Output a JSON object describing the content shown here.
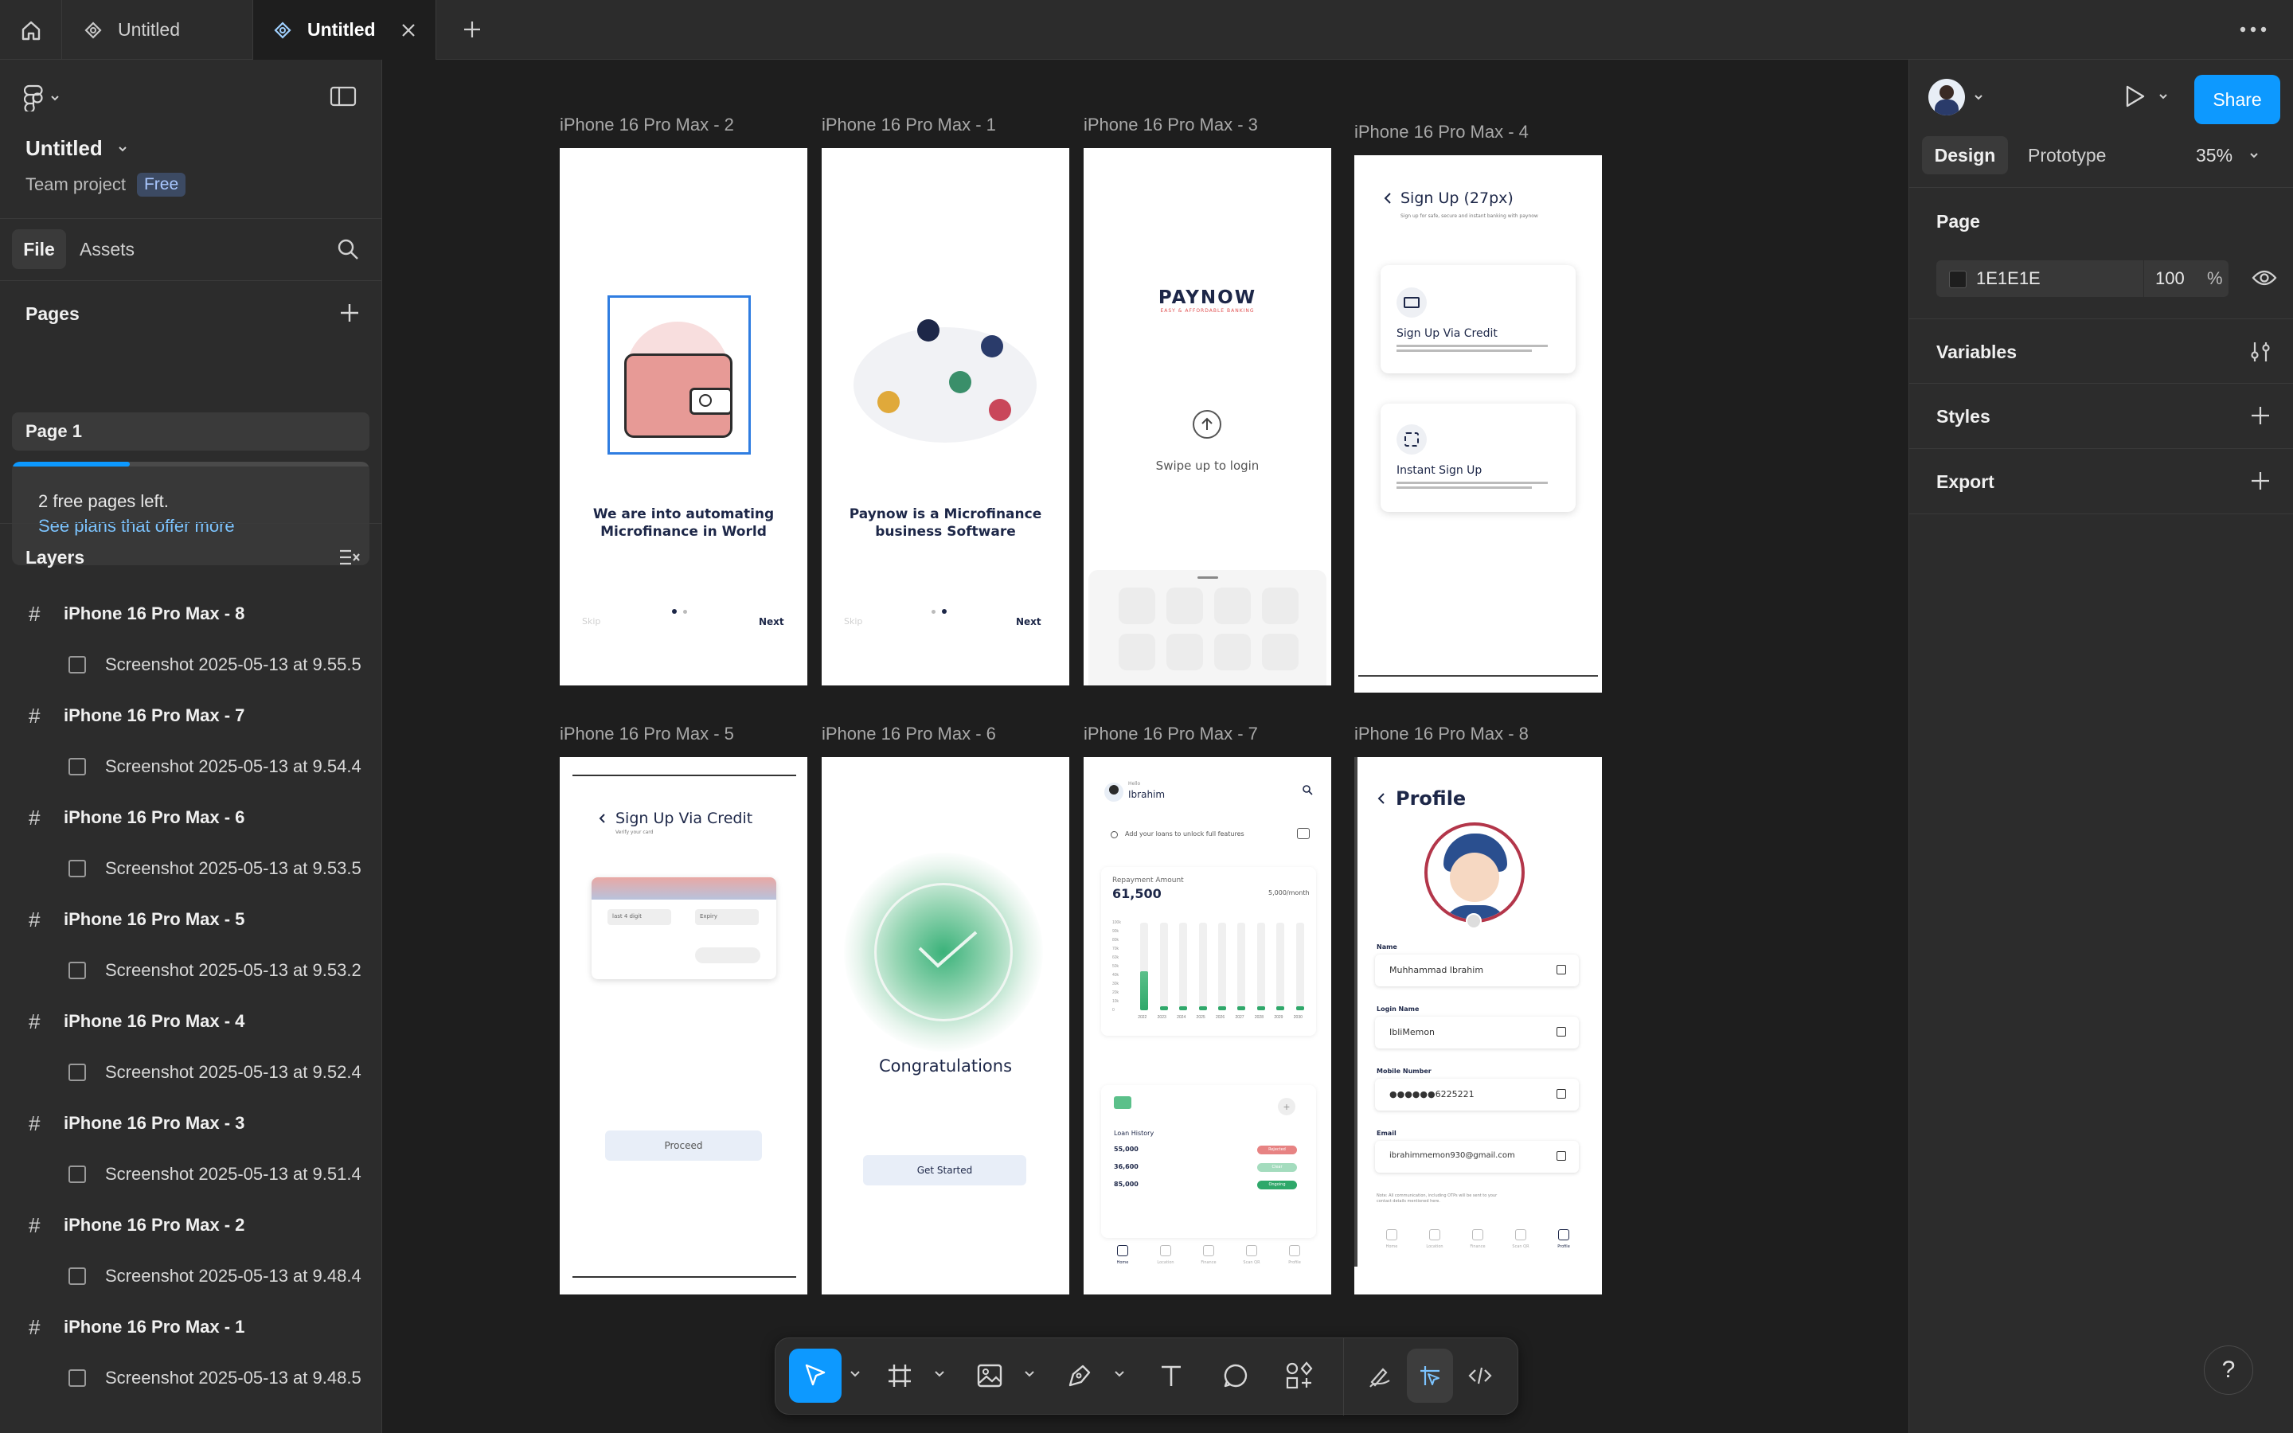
{
  "tabs": {
    "home_icon": "home-icon",
    "items": [
      {
        "label": "Untitled",
        "active": false
      },
      {
        "label": "Untitled",
        "active": true
      }
    ],
    "new_tab_icon": "plus-icon",
    "more_icon": "more-horizontal-icon"
  },
  "file": {
    "name": "Untitled",
    "team": "Team project",
    "plan_badge": "Free"
  },
  "left_tabs": {
    "file": "File",
    "assets": "Assets"
  },
  "pages": {
    "heading": "Pages",
    "items": [
      "Page 1"
    ],
    "limit_text": "2 free pages left.",
    "plans_link": "See plans that offer more",
    "usage_fraction": 0.33
  },
  "layers": {
    "heading": "Layers",
    "items": [
      {
        "frame": "iPhone 16 Pro Max - 8",
        "child": "Screenshot 2025-05-13 at 9.55.5"
      },
      {
        "frame": "iPhone 16 Pro Max - 7",
        "child": "Screenshot 2025-05-13 at 9.54.4"
      },
      {
        "frame": "iPhone 16 Pro Max - 6",
        "child": "Screenshot 2025-05-13 at 9.53.5"
      },
      {
        "frame": "iPhone 16 Pro Max - 5",
        "child": "Screenshot 2025-05-13 at 9.53.2"
      },
      {
        "frame": "iPhone 16 Pro Max - 4",
        "child": "Screenshot 2025-05-13 at 9.52.4"
      },
      {
        "frame": "iPhone 16 Pro Max - 3",
        "child": "Screenshot 2025-05-13 at 9.51.4"
      },
      {
        "frame": "iPhone 16 Pro Max - 2",
        "child": "Screenshot 2025-05-13 at 9.48.4"
      },
      {
        "frame": "iPhone 16 Pro Max - 1",
        "child": "Screenshot 2025-05-13 at 9.48.5"
      }
    ]
  },
  "right": {
    "share": "Share",
    "tab_design": "Design",
    "tab_prototype": "Prototype",
    "zoom": "35%",
    "page_heading": "Page",
    "page_color": "1E1E1E",
    "page_opacity": "100",
    "percent": "%",
    "variables": "Variables",
    "styles": "Styles",
    "export": "Export"
  },
  "frames": {
    "f2": {
      "label": "iPhone 16 Pro Max - 2",
      "headline1": "We are into automating",
      "headline2": "Microfinance in World",
      "skip": "Skip",
      "next": "Next"
    },
    "f1": {
      "label": "iPhone 16 Pro Max - 1",
      "headline1": "Paynow is a Microfinance",
      "headline2": "business  Software",
      "skip": "Skip",
      "next": "Next"
    },
    "f3": {
      "label": "iPhone 16 Pro Max - 3",
      "brand": "PAYNOW",
      "tagline": "EASY & AFFORDABLE BANKING",
      "swipe": "Swipe up to login"
    },
    "f4": {
      "label": "iPhone 16 Pro Max - 4",
      "title": "Sign Up (27px)",
      "subtitle": "Sign up for safe, secure and instant banking with paynow",
      "opt1": "Sign Up Via Credit",
      "opt2": "Instant Sign Up"
    },
    "f5": {
      "label": "iPhone 16 Pro Max - 5",
      "title": "Sign Up Via Credit",
      "subtitle": "Verify your card",
      "last4": "last 4 digit",
      "expiry": "Expiry",
      "proceed": "Proceed"
    },
    "f6": {
      "label": "iPhone 16 Pro Max - 6",
      "congrats": "Congratulations",
      "cta": "Get Started"
    },
    "f7": {
      "label": "iPhone 16 Pro Max - 7",
      "hello": "Hello",
      "name": "Ibrahim",
      "notice": "Add your loans to unlock full features",
      "repay_label": "Repayment Amount",
      "repay_value": "61,500",
      "per_month": "5,000/month",
      "y_ticks": [
        "100k",
        "90k",
        "80k",
        "70k",
        "60k",
        "50k",
        "40k",
        "30k",
        "20k",
        "10k",
        "0"
      ],
      "years": [
        "2022",
        "2023",
        "2024",
        "2025",
        "2026",
        "2027",
        "2028",
        "2029",
        "2030"
      ],
      "bar_fill": [
        0.45,
        0.05,
        0.05,
        0.05,
        0.05,
        0.05,
        0.05,
        0.05,
        0.05
      ],
      "loan_history": "Loan History",
      "loans": [
        {
          "amount": "55,000",
          "status": "Rejected",
          "color": "#e05a5a"
        },
        {
          "amount": "36,600",
          "status": "Clear",
          "color": "#5bc08a"
        },
        {
          "amount": "85,000",
          "status": "Ongoing",
          "color": "#2fa86a"
        }
      ],
      "nav": [
        "Home",
        "Location",
        "Finance",
        "Scan QR",
        "Profile"
      ]
    },
    "f8": {
      "label": "iPhone 16 Pro Max - 8",
      "title": "Profile",
      "fields": [
        {
          "label": "Name",
          "value": "Muhhammad Ibrahim"
        },
        {
          "label": "Login Name",
          "value": "IbliMemon"
        },
        {
          "label": "Mobile Number",
          "value": "●●●●●●6225221"
        },
        {
          "label": "Email",
          "value": "ibrahimmemon930@gmail.com"
        }
      ],
      "note": "Note: All communication, including OTPs will be sent to your contact details mentioned here.",
      "nav": [
        "Home",
        "Location",
        "Finance",
        "Scan QR",
        "Profile"
      ]
    }
  },
  "toolbar": {
    "tools": [
      "move-tool-icon",
      "frame-tool-icon",
      "image-tool-icon",
      "pen-tool-icon",
      "text-tool-icon",
      "comment-tool-icon",
      "components-icon",
      "draw-mode-icon",
      "design-mode-icon",
      "dev-mode-icon"
    ]
  },
  "help": "?",
  "colors": {
    "accent": "#0d99ff",
    "canvas": "#1e1e1e",
    "panel": "#2c2c2c",
    "brand_red": "#e05050",
    "navy": "#1d2748",
    "green": "#2fa86a"
  }
}
